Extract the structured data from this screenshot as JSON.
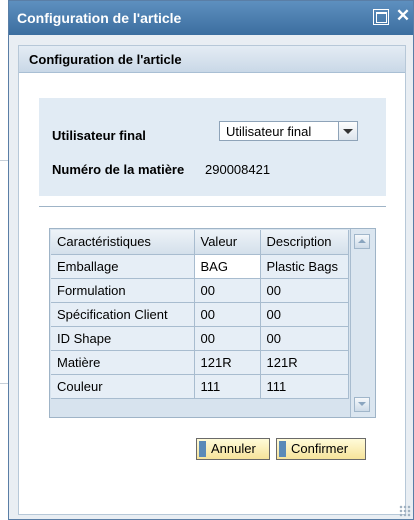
{
  "dialog": {
    "title": "Configuration de l'article",
    "maximize_glyph": "",
    "close_glyph": "✕"
  },
  "panel": {
    "title": "Configuration de l'article"
  },
  "form": {
    "user_label": "Utilisateur final",
    "user_value": "Utilisateur final",
    "material_label": "Numéro de la matière",
    "material_value": "290008421"
  },
  "table": {
    "headers": [
      "Caractéristiques",
      "Valeur",
      "Description"
    ],
    "rows": [
      [
        "Emballage",
        "BAG",
        "Plastic Bags"
      ],
      [
        "Formulation",
        "00",
        "00"
      ],
      [
        "Spécification Client",
        "00",
        "00"
      ],
      [
        "ID Shape",
        "00",
        "00"
      ],
      [
        "Matière",
        "121R",
        "121R"
      ],
      [
        "Couleur",
        "111",
        "111"
      ]
    ]
  },
  "buttons": {
    "cancel": "Annuler",
    "confirm": "Confirmer"
  }
}
